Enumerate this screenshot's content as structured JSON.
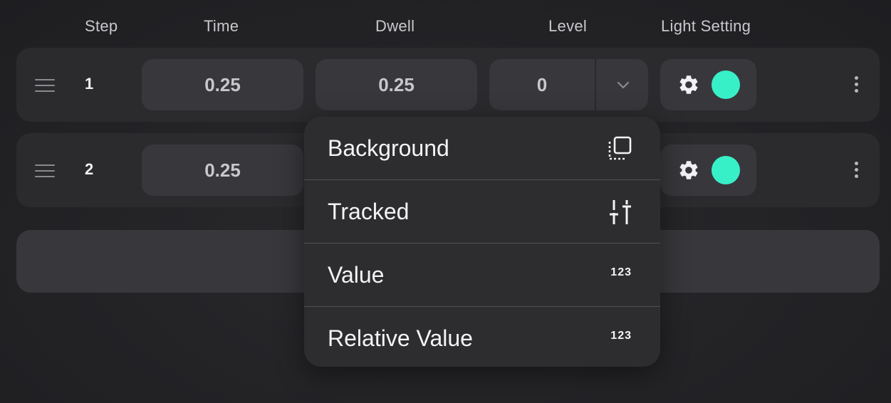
{
  "headers": {
    "step": "Step",
    "time": "Time",
    "dwell": "Dwell",
    "level": "Level",
    "light_setting": "Light Setting"
  },
  "rows": [
    {
      "step": "1",
      "time": "0.25",
      "dwell": "0.25",
      "level": "0",
      "light_color": "#38f0c8"
    },
    {
      "step": "2",
      "time": "0.25",
      "light_color": "#38f0c8"
    }
  ],
  "menu": {
    "items": [
      {
        "label": "Background",
        "icon": "background-layer-icon"
      },
      {
        "label": "Tracked",
        "icon": "tracked-sliders-icon"
      },
      {
        "label": "Value",
        "icon": "number-123-icon",
        "icon_text": "123"
      },
      {
        "label": "Relative Value",
        "icon": "number-123-icon",
        "icon_text": "123"
      }
    ]
  },
  "colors": {
    "accent": "#38f0c8",
    "background": "#232326",
    "panel": "#2b2b2e",
    "field": "#38383c"
  }
}
